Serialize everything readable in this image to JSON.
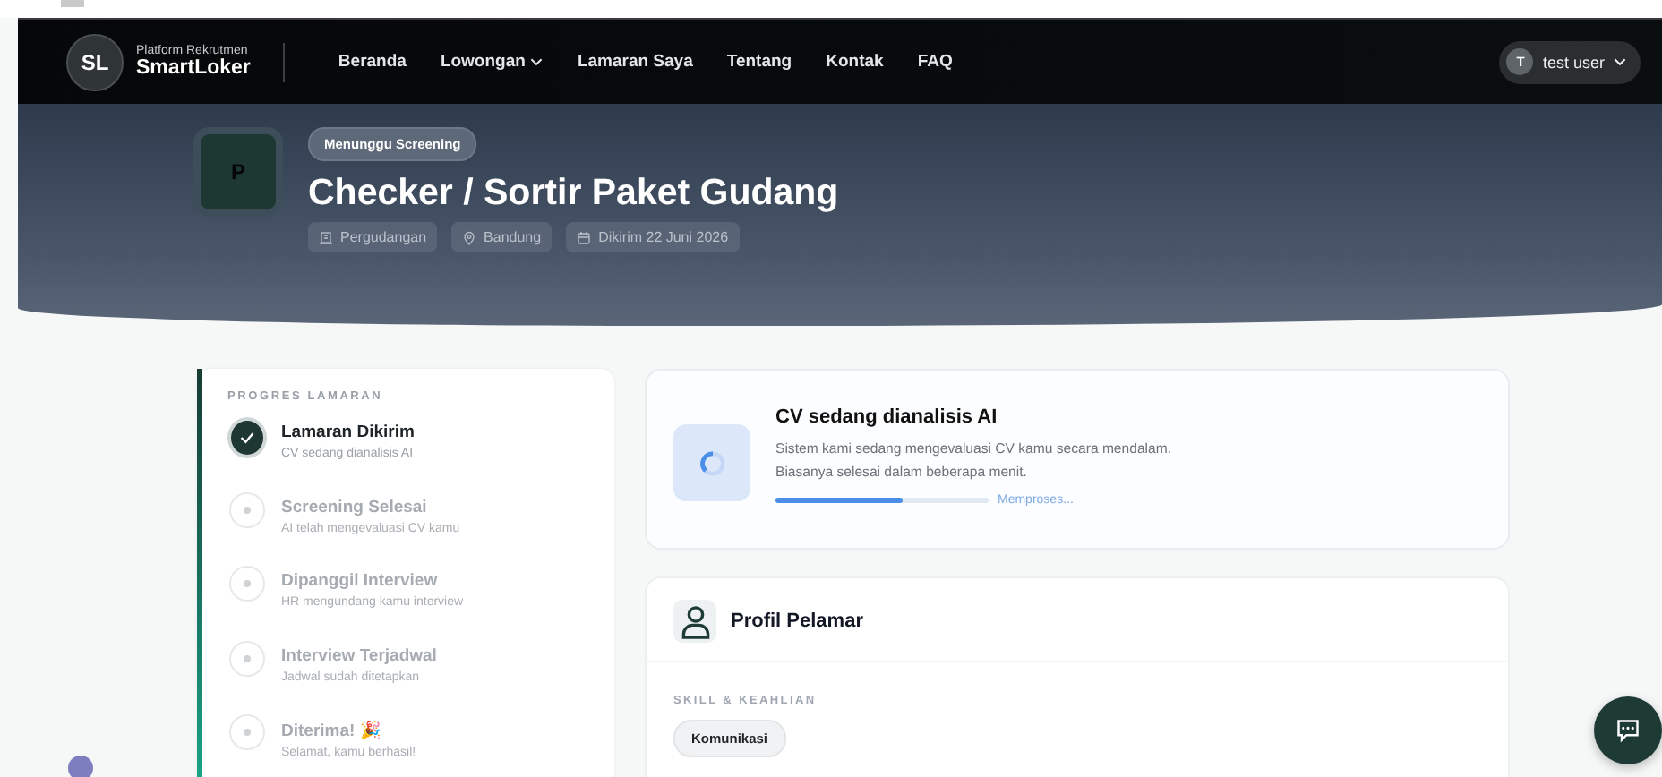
{
  "brand": {
    "initials": "SL",
    "tagline": "Platform Rekrutmen",
    "name": "SmartLoker"
  },
  "nav": [
    {
      "label": "Beranda",
      "dropdown": false
    },
    {
      "label": "Lowongan",
      "dropdown": true
    },
    {
      "label": "Lamaran Saya",
      "dropdown": false
    },
    {
      "label": "Tentang",
      "dropdown": false
    },
    {
      "label": "Kontak",
      "dropdown": false
    },
    {
      "label": "FAQ",
      "dropdown": false
    }
  ],
  "user": {
    "initial": "T",
    "name": "test user"
  },
  "job": {
    "logo_letter": "P",
    "status": "Menunggu Screening",
    "title": "Checker / Sortir Paket Gudang",
    "meta": [
      {
        "kind": "category",
        "text": "Pergudangan"
      },
      {
        "kind": "location",
        "text": "Bandung"
      },
      {
        "kind": "date",
        "text": "Dikirim 22 Juni 2026"
      }
    ]
  },
  "progress": {
    "heading": "PROGRES LAMARAN",
    "steps": [
      {
        "title": "Lamaran Dikirim",
        "subtitle": "CV sedang dianalisis AI",
        "done": true
      },
      {
        "title": "Screening Selesai",
        "subtitle": "AI telah mengevaluasi CV kamu",
        "done": false
      },
      {
        "title": "Dipanggil Interview",
        "subtitle": "HR mengundang kamu interview",
        "done": false
      },
      {
        "title": "Interview Terjadwal",
        "subtitle": "Jadwal sudah ditetapkan",
        "done": false
      },
      {
        "title": "Diterima! 🎉",
        "subtitle": "Selamat, kamu berhasil!",
        "done": false
      }
    ]
  },
  "analysis": {
    "title": "CV sedang dianalisis AI",
    "lines": [
      "Sistem kami sedang mengevaluasi CV kamu secara mendalam.",
      "Biasanya selesai dalam beberapa menit."
    ],
    "level": 0.6,
    "status": "Memproses..."
  },
  "profile": {
    "title": "Profil Pelamar",
    "skills_heading": "SKILL & KEAHLIAN",
    "skills": [
      "Komunikasi"
    ]
  }
}
